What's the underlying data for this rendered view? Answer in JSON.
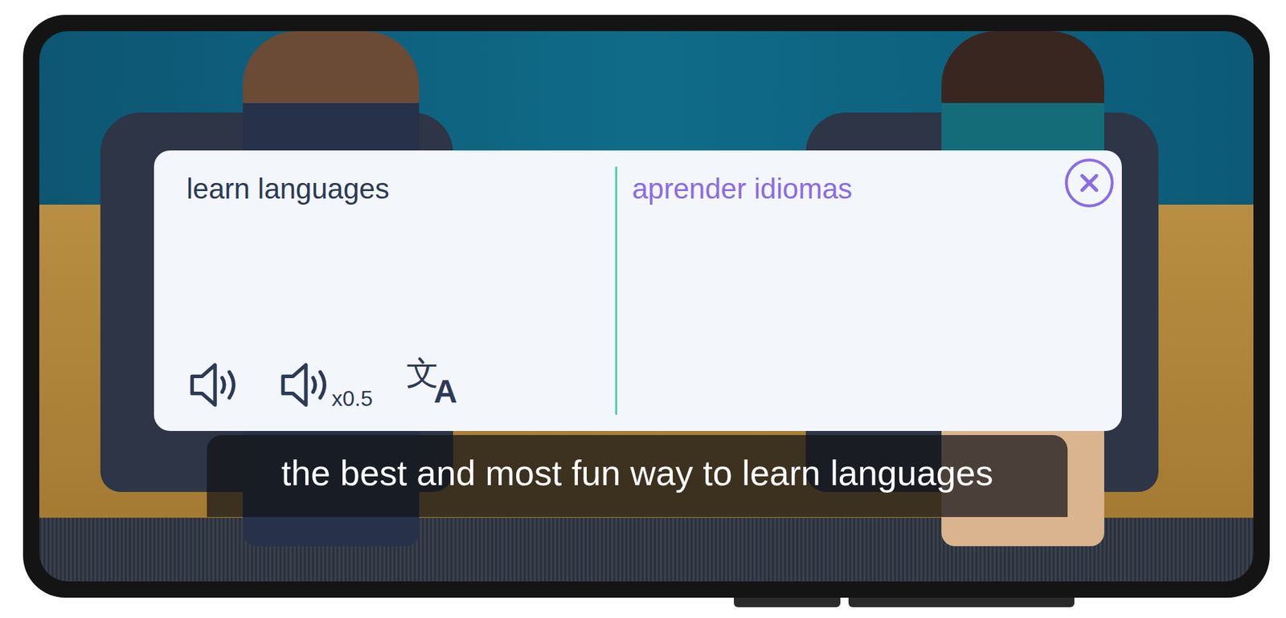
{
  "popup": {
    "source_text": "learn languages",
    "translation": "aprender idiomas",
    "slow_speed_label": "x0.5",
    "translate_icon_glyphs": [
      "文",
      "A"
    ]
  },
  "subtitle": {
    "text": "the best and most fun way to learn languages"
  }
}
